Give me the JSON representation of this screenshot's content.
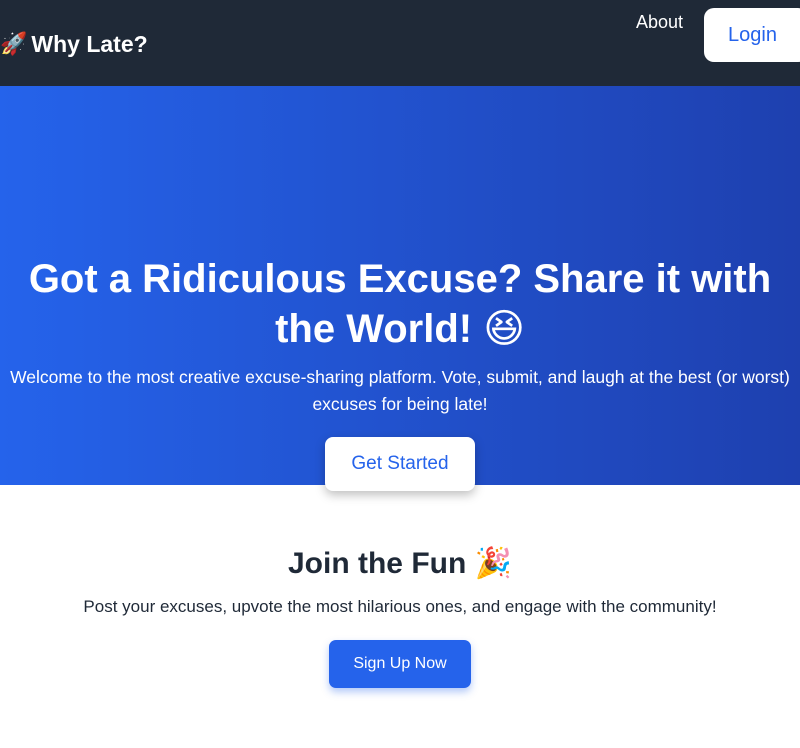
{
  "nav": {
    "brand_icon": "🚀",
    "brand": "Why Late?",
    "about": "About",
    "login": "Login"
  },
  "hero": {
    "title_line1": "Got a Ridiculous Excuse? Share it with",
    "title_line2": "the World! 😆",
    "subtitle": "Welcome to the most creative excuse-sharing platform. Vote, submit, and laugh at the best (or worst) excuses for being late!",
    "cta": "Get Started"
  },
  "join": {
    "title": "Join the Fun 🎉",
    "subtitle": "Post your excuses, upvote the most hilarious ones, and engage with the community!",
    "cta": "Sign Up Now"
  },
  "colors": {
    "navbar": "#1f2937",
    "accent": "#2563eb",
    "hero_gradient_end": "#1e40af"
  }
}
